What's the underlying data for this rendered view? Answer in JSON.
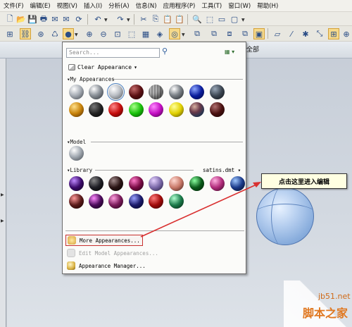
{
  "menu": [
    "文件(F)",
    "编辑(E)",
    "视图(V)",
    "插入(I)",
    "分析(A)",
    "信息(N)",
    "应用程序(P)",
    "工具(T)",
    "窗口(W)",
    "帮助(H)"
  ],
  "tab_text": "全部",
  "panel": {
    "search_placeholder": "Search...",
    "clear_label": "Clear Appearance",
    "my_appearances_label": "My Appearances",
    "model_label": "Model",
    "library_label": "Library",
    "library_file": "satins.dmt",
    "more_label": "More Appearances...",
    "edit_label": "Edit Model Appearances...",
    "manager_label": "Appearance Manager..."
  },
  "callout_text": "点击这里进入编辑",
  "watermark": {
    "site": "jb51.net",
    "name": "脚本之家"
  },
  "colors": {
    "accent_red": "#d93030",
    "selection_blue": "#4a7ebf",
    "callout_bg": "#ffffe2"
  }
}
